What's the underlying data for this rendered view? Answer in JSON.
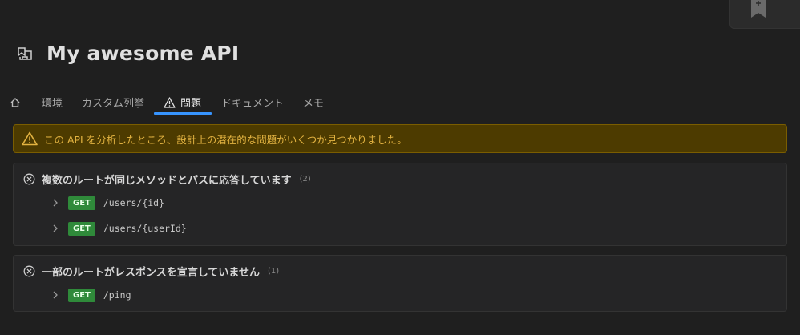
{
  "api": {
    "title": "My awesome API",
    "icon": "api-bookmark-icon"
  },
  "tabs": [
    {
      "label": "",
      "icon": "home-icon"
    },
    {
      "label": "環境"
    },
    {
      "label": "カスタム列挙"
    },
    {
      "label": "問題",
      "icon": "warning-icon",
      "active": true
    },
    {
      "label": "ドキュメント"
    },
    {
      "label": "メモ"
    }
  ],
  "banner": {
    "text": "この API を分析したところ、設計上の潜在的な問題がいくつか見つかりました。"
  },
  "issues": [
    {
      "title": "複数のルートが同じメソッドとパスに応答しています",
      "count": "(2)",
      "routes": [
        {
          "method": "GET",
          "path": "/users/{id}"
        },
        {
          "method": "GET",
          "path": "/users/{userId}"
        }
      ]
    },
    {
      "title": "一部のルートがレスポンスを宣言していません",
      "count": "(1)",
      "routes": [
        {
          "method": "GET",
          "path": "/ping"
        }
      ]
    }
  ],
  "colors": {
    "accent": "#3794ff",
    "warning": "#e3b341",
    "get": "#2f8a3a"
  }
}
